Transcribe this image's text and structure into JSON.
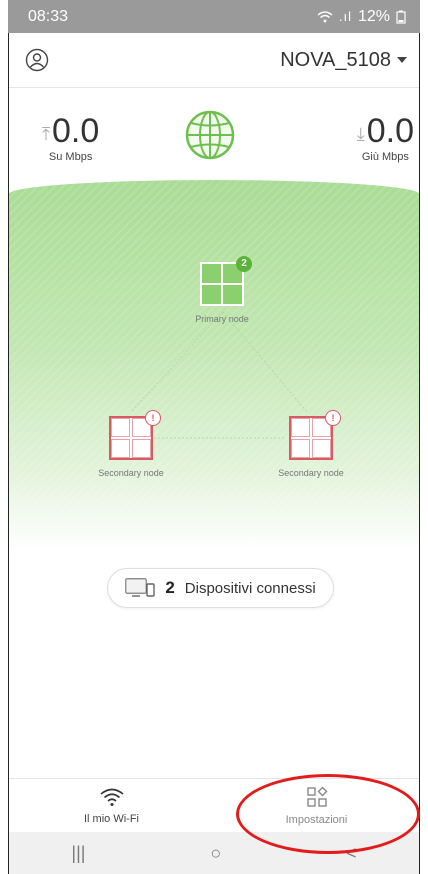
{
  "status_bar": {
    "time": "08:33",
    "battery": "12%"
  },
  "header": {
    "network_name": "NOVA_5108"
  },
  "speed": {
    "upload_value": "0.0",
    "upload_unit": "Su Mbps",
    "download_value": "0.0",
    "download_unit": "Giù Mbps"
  },
  "topology": {
    "primary": {
      "label": "Primary node",
      "badge": "2"
    },
    "secondary_left": {
      "label": "Secondary node",
      "badge": "!"
    },
    "secondary_right": {
      "label": "Secondary node",
      "badge": "!"
    }
  },
  "devices": {
    "count": "2",
    "label": "Dispositivi connessi"
  },
  "tabs": [
    {
      "label": "Il mio Wi-Fi",
      "icon": "wifi-icon"
    },
    {
      "label": "Impostazioni",
      "icon": "settings-grid-icon"
    }
  ],
  "nav": {
    "recent": "|||",
    "home": "○",
    "back": "<"
  },
  "colors": {
    "accent_green": "#5bb33a",
    "alert_red": "#d85a63",
    "highlight_circle": "#e21b1b"
  }
}
